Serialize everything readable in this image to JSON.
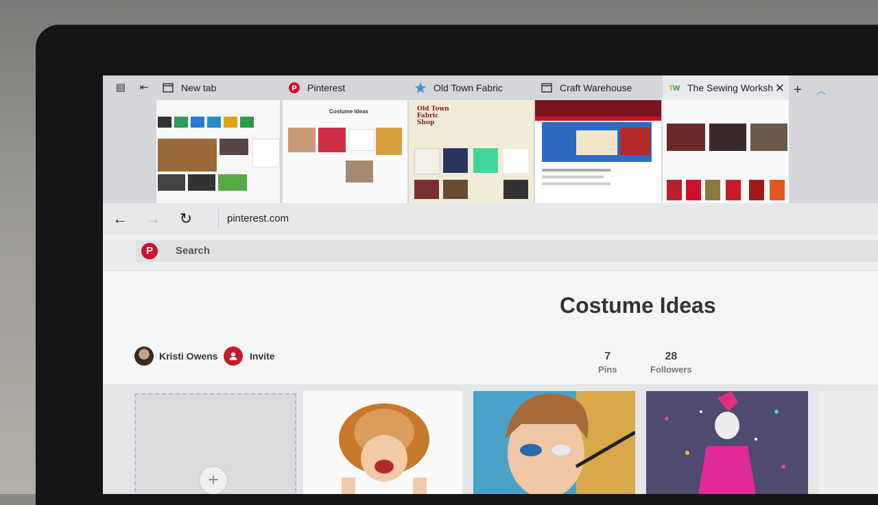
{
  "tabs": [
    {
      "label": "New tab",
      "icon": "new-tab-icon"
    },
    {
      "label": "Pinterest",
      "icon": "pinterest-icon"
    },
    {
      "label": "Old Town Fabric",
      "icon": "star-icon"
    },
    {
      "label": "Craft Warehouse",
      "icon": "page-icon"
    },
    {
      "label": "The Sewing Worksh",
      "icon": "sewing-icon",
      "active": true
    }
  ],
  "thumbnails": {
    "pinterest_heading": "Costume Ideas",
    "oldtown_heading": "Old Town Fabric Shop"
  },
  "address": {
    "url": "pinterest.com"
  },
  "pinterest": {
    "search_label": "Search",
    "logo": "P"
  },
  "board": {
    "title": "Costume Ideas",
    "owner": "Kristi Owens",
    "invite_label": "Invite",
    "pins_count": "7",
    "pins_label": "Pins",
    "followers_count": "28",
    "followers_label": "Followers"
  },
  "add_pin_symbol": "+",
  "colors": {
    "accent": "#d0112b",
    "tab_bar": "#d4d6d9"
  }
}
